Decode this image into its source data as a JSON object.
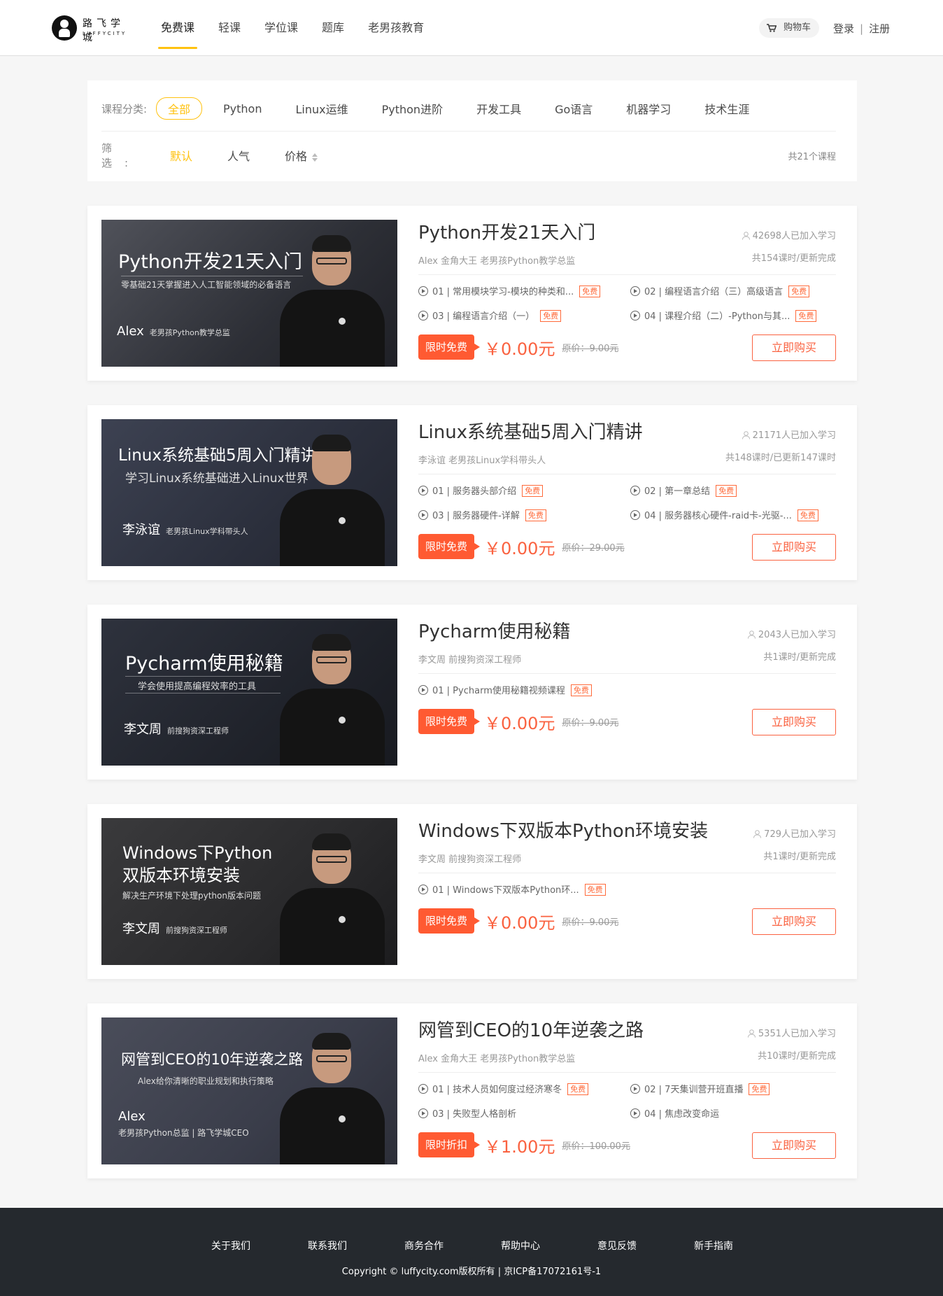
{
  "header": {
    "logo_cn": "路飞学城",
    "logo_en": "LUFFYCITY",
    "nav": [
      "免费课",
      "轻课",
      "学位课",
      "题库",
      "老男孩教育"
    ],
    "cart": "购物车",
    "login": "登录",
    "register": "注册",
    "sep": "|"
  },
  "filter": {
    "category_label": "课程分类:",
    "categories": [
      "全部",
      "Python",
      "Linux运维",
      "Python进阶",
      "开发工具",
      "Go语言",
      "机器学习",
      "技术生涯"
    ],
    "filter_label": "筛　选:",
    "sorts": [
      "默认",
      "人气",
      "价格"
    ],
    "total": "共21个课程"
  },
  "courses": [
    {
      "title": "Python开发21天入门",
      "students": "42698人已加入学习",
      "teacher": "Alex 金角大王 老男孩Python教学总监",
      "lessons": "共154课时/更新完成",
      "chapters": [
        {
          "text": "01 | 常用模块学习-模块的种类和...",
          "free": "免费"
        },
        {
          "text": "02 | 编程语言介绍（三）高级语言",
          "free": "免费"
        },
        {
          "text": "03 | 编程语言介绍（一）",
          "free": "免费"
        },
        {
          "text": "04 | 课程介绍（二）-Python与其...",
          "free": "免费"
        }
      ],
      "tag": "限时免费",
      "price": "￥0.00元",
      "original": "原价：9.00元",
      "buy": "立即购买",
      "banner": {
        "title": "Python开发21天入门",
        "sub": "零基础21天掌握进入人工智能领域的必备语言",
        "name": "Alex",
        "role": "老男孩Python教学总监"
      }
    },
    {
      "title": "Linux系统基础5周入门精讲",
      "students": "21171人已加入学习",
      "teacher": "李泳谊 老男孩Linux学科带头人",
      "lessons": "共148课时/已更新147课时",
      "chapters": [
        {
          "text": "01 | 服务器头部介绍",
          "free": "免费"
        },
        {
          "text": "02 | 第一章总结",
          "free": "免费"
        },
        {
          "text": "03 | 服务器硬件-详解",
          "free": "免费"
        },
        {
          "text": "04 | 服务器核心硬件-raid卡-光驱-...",
          "free": "免费"
        }
      ],
      "tag": "限时免费",
      "price": "￥0.00元",
      "original": "原价：29.00元",
      "buy": "立即购买",
      "banner": {
        "title": "Linux系统基础5周入门精讲",
        "sub": "学习Linux系统基础进入Linux世界",
        "name": "李泳谊",
        "role": "老男孩Linux学科带头人"
      }
    },
    {
      "title": "Pycharm使用秘籍",
      "students": "2043人已加入学习",
      "teacher": "李文周 前搜狗资深工程师",
      "lessons": "共1课时/更新完成",
      "chapters": [
        {
          "text": "01 | Pycharm使用秘籍视频课程",
          "free": "免费"
        }
      ],
      "tag": "限时免费",
      "price": "￥0.00元",
      "original": "原价：9.00元",
      "buy": "立即购买",
      "banner": {
        "title": "Pycharm使用秘籍",
        "sub": "学会使用提高编程效率的工具",
        "name": "李文周",
        "role": "前搜狗资深工程师"
      }
    },
    {
      "title": "Windows下双版本Python环境安装",
      "students": "729人已加入学习",
      "teacher": "李文周 前搜狗资深工程师",
      "lessons": "共1课时/更新完成",
      "chapters": [
        {
          "text": "01 | Windows下双版本Python环...",
          "free": "免费"
        }
      ],
      "tag": "限时免费",
      "price": "￥0.00元",
      "original": "原价：9.00元",
      "buy": "立即购买",
      "banner": {
        "title": "Windows下Python",
        "title2": "双版本环境安装",
        "sub": "解决生产环境下处理python版本问题",
        "name": "李文周",
        "role": "前搜狗资深工程师"
      }
    },
    {
      "title": "网管到CEO的10年逆袭之路",
      "students": "5351人已加入学习",
      "teacher": "Alex 金角大王 老男孩Python教学总监",
      "lessons": "共10课时/更新完成",
      "chapters": [
        {
          "text": "01 | 技术人员如何度过经济寒冬",
          "free": "免费"
        },
        {
          "text": "02 | 7天集训营开班直播",
          "free": "免费"
        },
        {
          "text": "03 | 失败型人格剖析",
          "free": ""
        },
        {
          "text": "04 | 焦虑改变命运",
          "free": ""
        }
      ],
      "tag": "限时折扣",
      "price": "￥1.00元",
      "original": "原价：100.00元",
      "buy": "立即购买",
      "banner": {
        "title": "网管到CEO的10年逆袭之路",
        "sub": "Alex给你清晰的职业规划和执行策略",
        "name": "Alex",
        "role": "老男孩Python总监 | 路飞学城CEO"
      }
    }
  ],
  "footer": {
    "links": [
      "关于我们",
      "联系我们",
      "商务合作",
      "帮助中心",
      "意见反馈",
      "新手指南"
    ],
    "copyright": "Copyright © luffycity.com版权所有 | 京ICP备17072161号-1"
  }
}
